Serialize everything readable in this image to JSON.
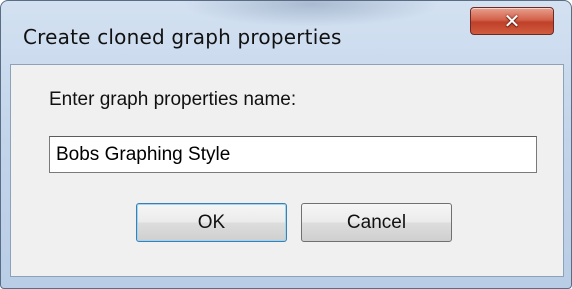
{
  "window": {
    "title": "Create cloned graph properties",
    "close_icon": "close-icon"
  },
  "form": {
    "prompt": "Enter graph properties name:",
    "name_value": "Bobs Graphing Style"
  },
  "buttons": {
    "ok_label": "OK",
    "cancel_label": "Cancel"
  },
  "colors": {
    "frame": "#c2d4ea",
    "close_button": "#c8442d",
    "client_bg": "#f0f0f0",
    "default_button_border": "#3c7fb1"
  }
}
